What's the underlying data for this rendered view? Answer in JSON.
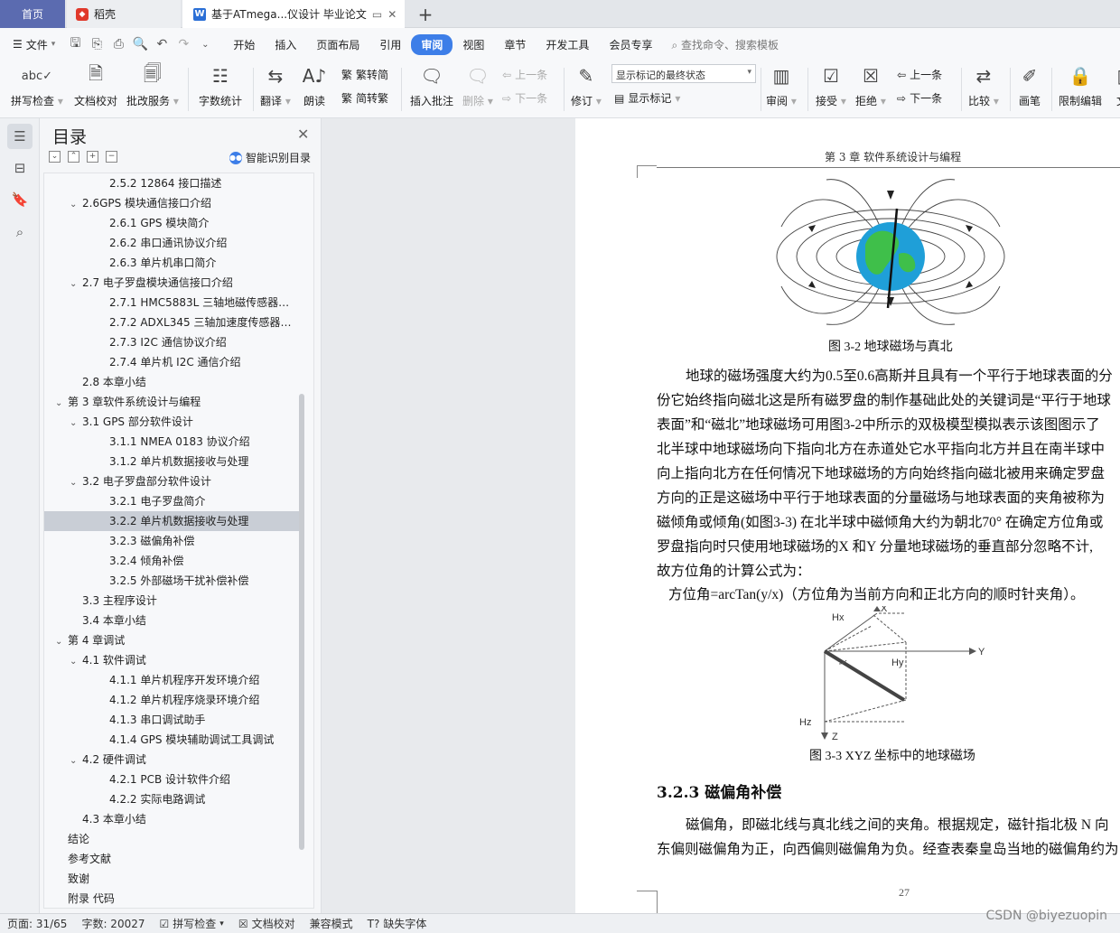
{
  "tabs": {
    "home": "首页",
    "daoke": "稻壳",
    "doc": "基于ATmega...仪设计 毕业论文",
    "new_tab": "+"
  },
  "menu": {
    "file": "文件",
    "items": [
      "开始",
      "插入",
      "页面布局",
      "引用",
      "审阅",
      "视图",
      "章节",
      "开发工具",
      "会员专享"
    ],
    "active": "审阅",
    "search": "查找命令、搜索模板"
  },
  "ribbon": {
    "spell_check": "拼写检查",
    "doc_proof": "文档校对",
    "batch_service": "批改服务",
    "word_count": "字数统计",
    "translate": "翻译",
    "read_aloud": "朗读",
    "trad_to_simp": "繁转简",
    "simp_to_trad": "简转繁",
    "insert_comment": "插入批注",
    "delete": "删除",
    "prev_comment": "上一条",
    "next_comment": "下一条",
    "track_changes": "修订",
    "markup_state": "显示标记的最终状态",
    "show_markup": "显示标记",
    "review": "审阅",
    "accept": "接受",
    "reject": "拒绝",
    "prev_change": "上一条",
    "next_change": "下一条",
    "compare": "比较",
    "pen": "画笔",
    "restrict_edit": "限制编辑",
    "doc_rights": "文"
  },
  "toc": {
    "title": "目录",
    "smart_label": "智能识别目录",
    "items": [
      {
        "text": "2.5.2 12864 接口描述",
        "level": 3,
        "arrow": ""
      },
      {
        "text": "2.6GPS 模块通信接口介绍",
        "level": 2,
        "arrow": "v"
      },
      {
        "text": "2.6.1 GPS 模块简介",
        "level": 3,
        "arrow": ""
      },
      {
        "text": "2.6.2 串口通讯协议介绍",
        "level": 3,
        "arrow": ""
      },
      {
        "text": "2.6.3 单片机串口简介",
        "level": 3,
        "arrow": ""
      },
      {
        "text": "2.7 电子罗盘模块通信接口介绍",
        "level": 2,
        "arrow": "v"
      },
      {
        "text": "2.7.1 HMC5883L 三轴地磁传感器介...",
        "level": 3,
        "arrow": ""
      },
      {
        "text": "2.7.2 ADXL345 三轴加速度传感器介...",
        "level": 3,
        "arrow": ""
      },
      {
        "text": "2.7.3 I2C 通信协议介绍",
        "level": 3,
        "arrow": ""
      },
      {
        "text": "2.7.4 单片机 I2C 通信介绍",
        "level": 3,
        "arrow": ""
      },
      {
        "text": "2.8 本章小结",
        "level": 2,
        "arrow": ""
      },
      {
        "text": "第 3 章软件系统设计与编程",
        "level": 1,
        "arrow": "v"
      },
      {
        "text": "3.1 GPS 部分软件设计",
        "level": 2,
        "arrow": "v"
      },
      {
        "text": "3.1.1 NMEA 0183 协议介绍",
        "level": 3,
        "arrow": ""
      },
      {
        "text": "3.1.2 单片机数据接收与处理",
        "level": 3,
        "arrow": ""
      },
      {
        "text": "3.2 电子罗盘部分软件设计",
        "level": 2,
        "arrow": "v"
      },
      {
        "text": "3.2.1 电子罗盘简介",
        "level": 3,
        "arrow": ""
      },
      {
        "text": "3.2.2 单片机数据接收与处理",
        "level": 3,
        "arrow": "",
        "selected": true
      },
      {
        "text": "3.2.3 磁偏角补偿",
        "level": 3,
        "arrow": ""
      },
      {
        "text": "3.2.4 倾角补偿",
        "level": 3,
        "arrow": ""
      },
      {
        "text": "3.2.5 外部磁场干扰补偿补偿",
        "level": 3,
        "arrow": ""
      },
      {
        "text": "3.3 主程序设计",
        "level": 2,
        "arrow": ""
      },
      {
        "text": "3.4 本章小结",
        "level": 2,
        "arrow": ""
      },
      {
        "text": "第 4 章调试",
        "level": 1,
        "arrow": "v"
      },
      {
        "text": "4.1 软件调试",
        "level": 2,
        "arrow": "v"
      },
      {
        "text": "4.1.1 单片机程序开发环境介绍",
        "level": 3,
        "arrow": ""
      },
      {
        "text": "4.1.2 单片机程序烧录环境介绍",
        "level": 3,
        "arrow": ""
      },
      {
        "text": "4.1.3 串口调试助手",
        "level": 3,
        "arrow": ""
      },
      {
        "text": "4.1.4 GPS 模块辅助调试工具调试",
        "level": 3,
        "arrow": ""
      },
      {
        "text": "4.2 硬件调试",
        "level": 2,
        "arrow": "v"
      },
      {
        "text": "4.2.1 PCB 设计软件介绍",
        "level": 3,
        "arrow": ""
      },
      {
        "text": "4.2.2 实际电路调试",
        "level": 3,
        "arrow": ""
      },
      {
        "text": "4.3 本章小结",
        "level": 2,
        "arrow": ""
      },
      {
        "text": "结论",
        "level": 1,
        "arrow": ""
      },
      {
        "text": "参考文献",
        "level": 1,
        "arrow": ""
      },
      {
        "text": "致谢",
        "level": 1,
        "arrow": ""
      },
      {
        "text": "附录 代码",
        "level": 1,
        "arrow": ""
      }
    ]
  },
  "page": {
    "header": "第 3 章 软件系统设计与编程",
    "fig2_caption": "图 3-2 地球磁场与真北",
    "paragraph1": [
      "地球的磁场强度大约为0.5至0.6高斯并且具有一个平行于地球表面的分",
      "份它始终指向磁北这是所有磁罗盘的制作基础此处的关键词是“平行于地球",
      "表面”和“磁北”地球磁场可用图3-2中所示的双极模型模拟表示该图图示了",
      "北半球中地球磁场向下指向北方在赤道处它水平指向北方并且在南半球中",
      "向上指向北方在任何情况下地球磁场的方向始终指向磁北被用来确定罗盘",
      "方向的正是这磁场中平行于地球表面的分量磁场与地球表面的夹角被称为",
      "磁倾角或倾角(如图3-3)  在北半球中磁倾角大约为朝北70°  在确定方位角或",
      "罗盘指向时只使用地球磁场的X 和Y 分量地球磁场的垂直部分忽略不计,",
      "故方位角的计算公式为："
    ],
    "formula": "方位角=arcTan(y/x)（方位角为当前方向和正北方向的顺时针夹角）。",
    "fig3_labels": {
      "hx": "Hx",
      "x": "X",
      "y": "Y",
      "hy": "Hy",
      "hz": "Hz",
      "z": "Z"
    },
    "fig3_caption": "图 3-3 XYZ 坐标中的地球磁场",
    "section_heading": "3.2.3 磁偏角补偿",
    "paragraph2": [
      "磁偏角，即磁北线与真北线之间的夹角。根据规定，磁针指北极 N 向",
      "东偏则磁偏角为正，向西偏则磁偏角为负。经查表秦皇岛当地的磁偏角约为"
    ],
    "page_number": "27"
  },
  "status": {
    "page": "页面: 31/65",
    "words": "字数: 20027",
    "spell": "拼写检查",
    "proof": "文档校对",
    "compat": "兼容模式",
    "missing_font": "缺失字体"
  },
  "watermark": "CSDN @biyezuopin",
  "colors": {
    "accent": "#3d7ee8",
    "home_tab": "#5b6bb0",
    "selected_toc": "#c9ced6"
  }
}
